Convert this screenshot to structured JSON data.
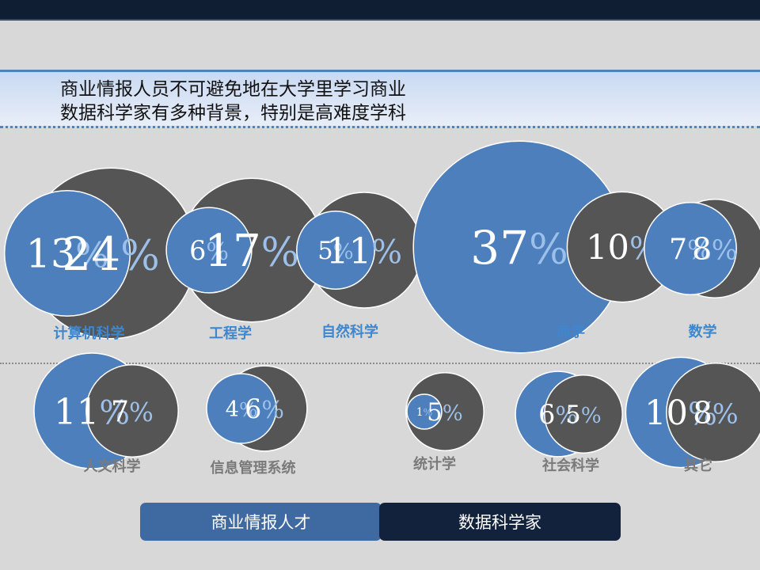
{
  "header": {
    "title_line1": "商业情报人员不可避免地在大学里学习商业",
    "title_line2": "数据科学家有多种背景，特别是高难度学科"
  },
  "colors": {
    "business_intelligence": "#4d7fbd",
    "data_scientist": "#555555",
    "label_top": "#3f86cc",
    "label_bottom": "#7a7a7a"
  },
  "legend": {
    "business_intelligence_label": "商业情报人才",
    "data_scientist_label": "数据科学家"
  },
  "chart_data": {
    "type": "bubble",
    "unit": "%",
    "series": [
      {
        "name": "商业情报人才"
      },
      {
        "name": "数据科学家"
      }
    ],
    "categories": [
      {
        "label": "计算机科学",
        "bi": 13,
        "ds": 24
      },
      {
        "label": "工程学",
        "bi": 6,
        "ds": 17
      },
      {
        "label": "自然科学",
        "bi": 5,
        "ds": 11
      },
      {
        "label": "商学",
        "bi": 37,
        "ds": 10
      },
      {
        "label": "数学",
        "bi": 7,
        "ds": 8
      },
      {
        "label": "人文科学",
        "bi": 11,
        "ds": 7
      },
      {
        "label": "信息管理系统",
        "bi": 4,
        "ds": 6
      },
      {
        "label": "统计学",
        "bi": 1,
        "ds": 5
      },
      {
        "label": "社会科学",
        "bi": 6,
        "ds": 5
      },
      {
        "label": "其它",
        "bi": 10,
        "ds": 8
      }
    ]
  }
}
